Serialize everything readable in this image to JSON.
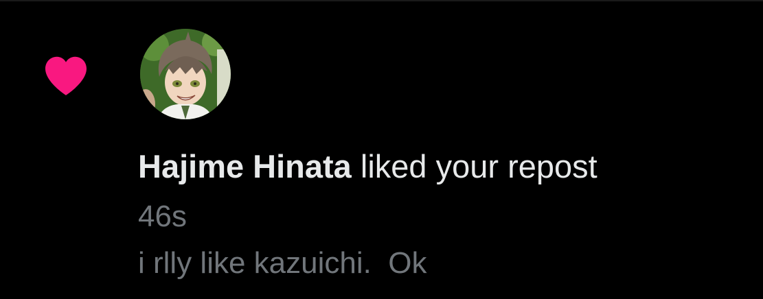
{
  "notification": {
    "actor_name": "Hajime Hinata",
    "action_text": " liked your repost",
    "timestamp": "46s",
    "post_text": "i rlly like kazuichi.  Ok",
    "icon": "heart-icon",
    "avatar_description_name": "avatar"
  },
  "colors": {
    "background": "#000000",
    "heart": "#f91880",
    "primary_text": "#e7e9ea",
    "secondary_text": "#71767b"
  }
}
